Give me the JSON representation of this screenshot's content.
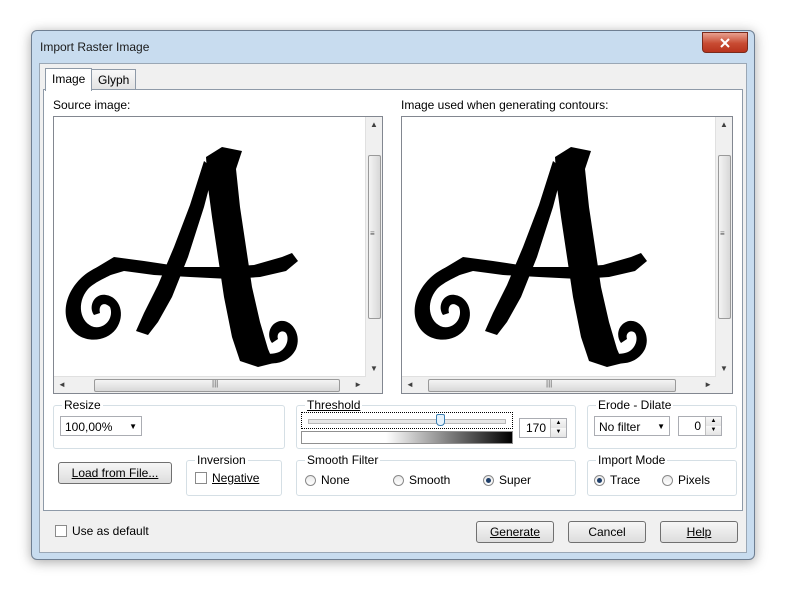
{
  "window": {
    "title": "Import Raster Image"
  },
  "tabs": [
    {
      "label": "Image",
      "active": true
    },
    {
      "label": "Glyph",
      "active": false
    }
  ],
  "source": {
    "label": "Source image:"
  },
  "result": {
    "label": "Image used when generating contours:"
  },
  "resize": {
    "title": "Resize",
    "value": "100,00%"
  },
  "threshold": {
    "title": "Threshold",
    "value": "170",
    "level": 170,
    "max": 255
  },
  "erode": {
    "title": "Erode - Dilate",
    "filter": "No filter",
    "value": "0"
  },
  "load_button": "Load from File...",
  "inversion": {
    "title": "Inversion",
    "negative_label": "Negative",
    "negative_checked": false
  },
  "smooth": {
    "title": "Smooth Filter",
    "options": [
      "None",
      "Smooth",
      "Super"
    ],
    "selected": "Super"
  },
  "import_mode": {
    "title": "Import Mode",
    "options": [
      "Trace",
      "Pixels"
    ],
    "selected": "Trace"
  },
  "use_default": {
    "label": "Use as default",
    "checked": false
  },
  "footer": {
    "generate": "Generate",
    "cancel": "Cancel",
    "help": "Help"
  },
  "colors": {
    "title_bar": "#c8dcef",
    "close": "#c84b32",
    "glyph": "#000000"
  }
}
